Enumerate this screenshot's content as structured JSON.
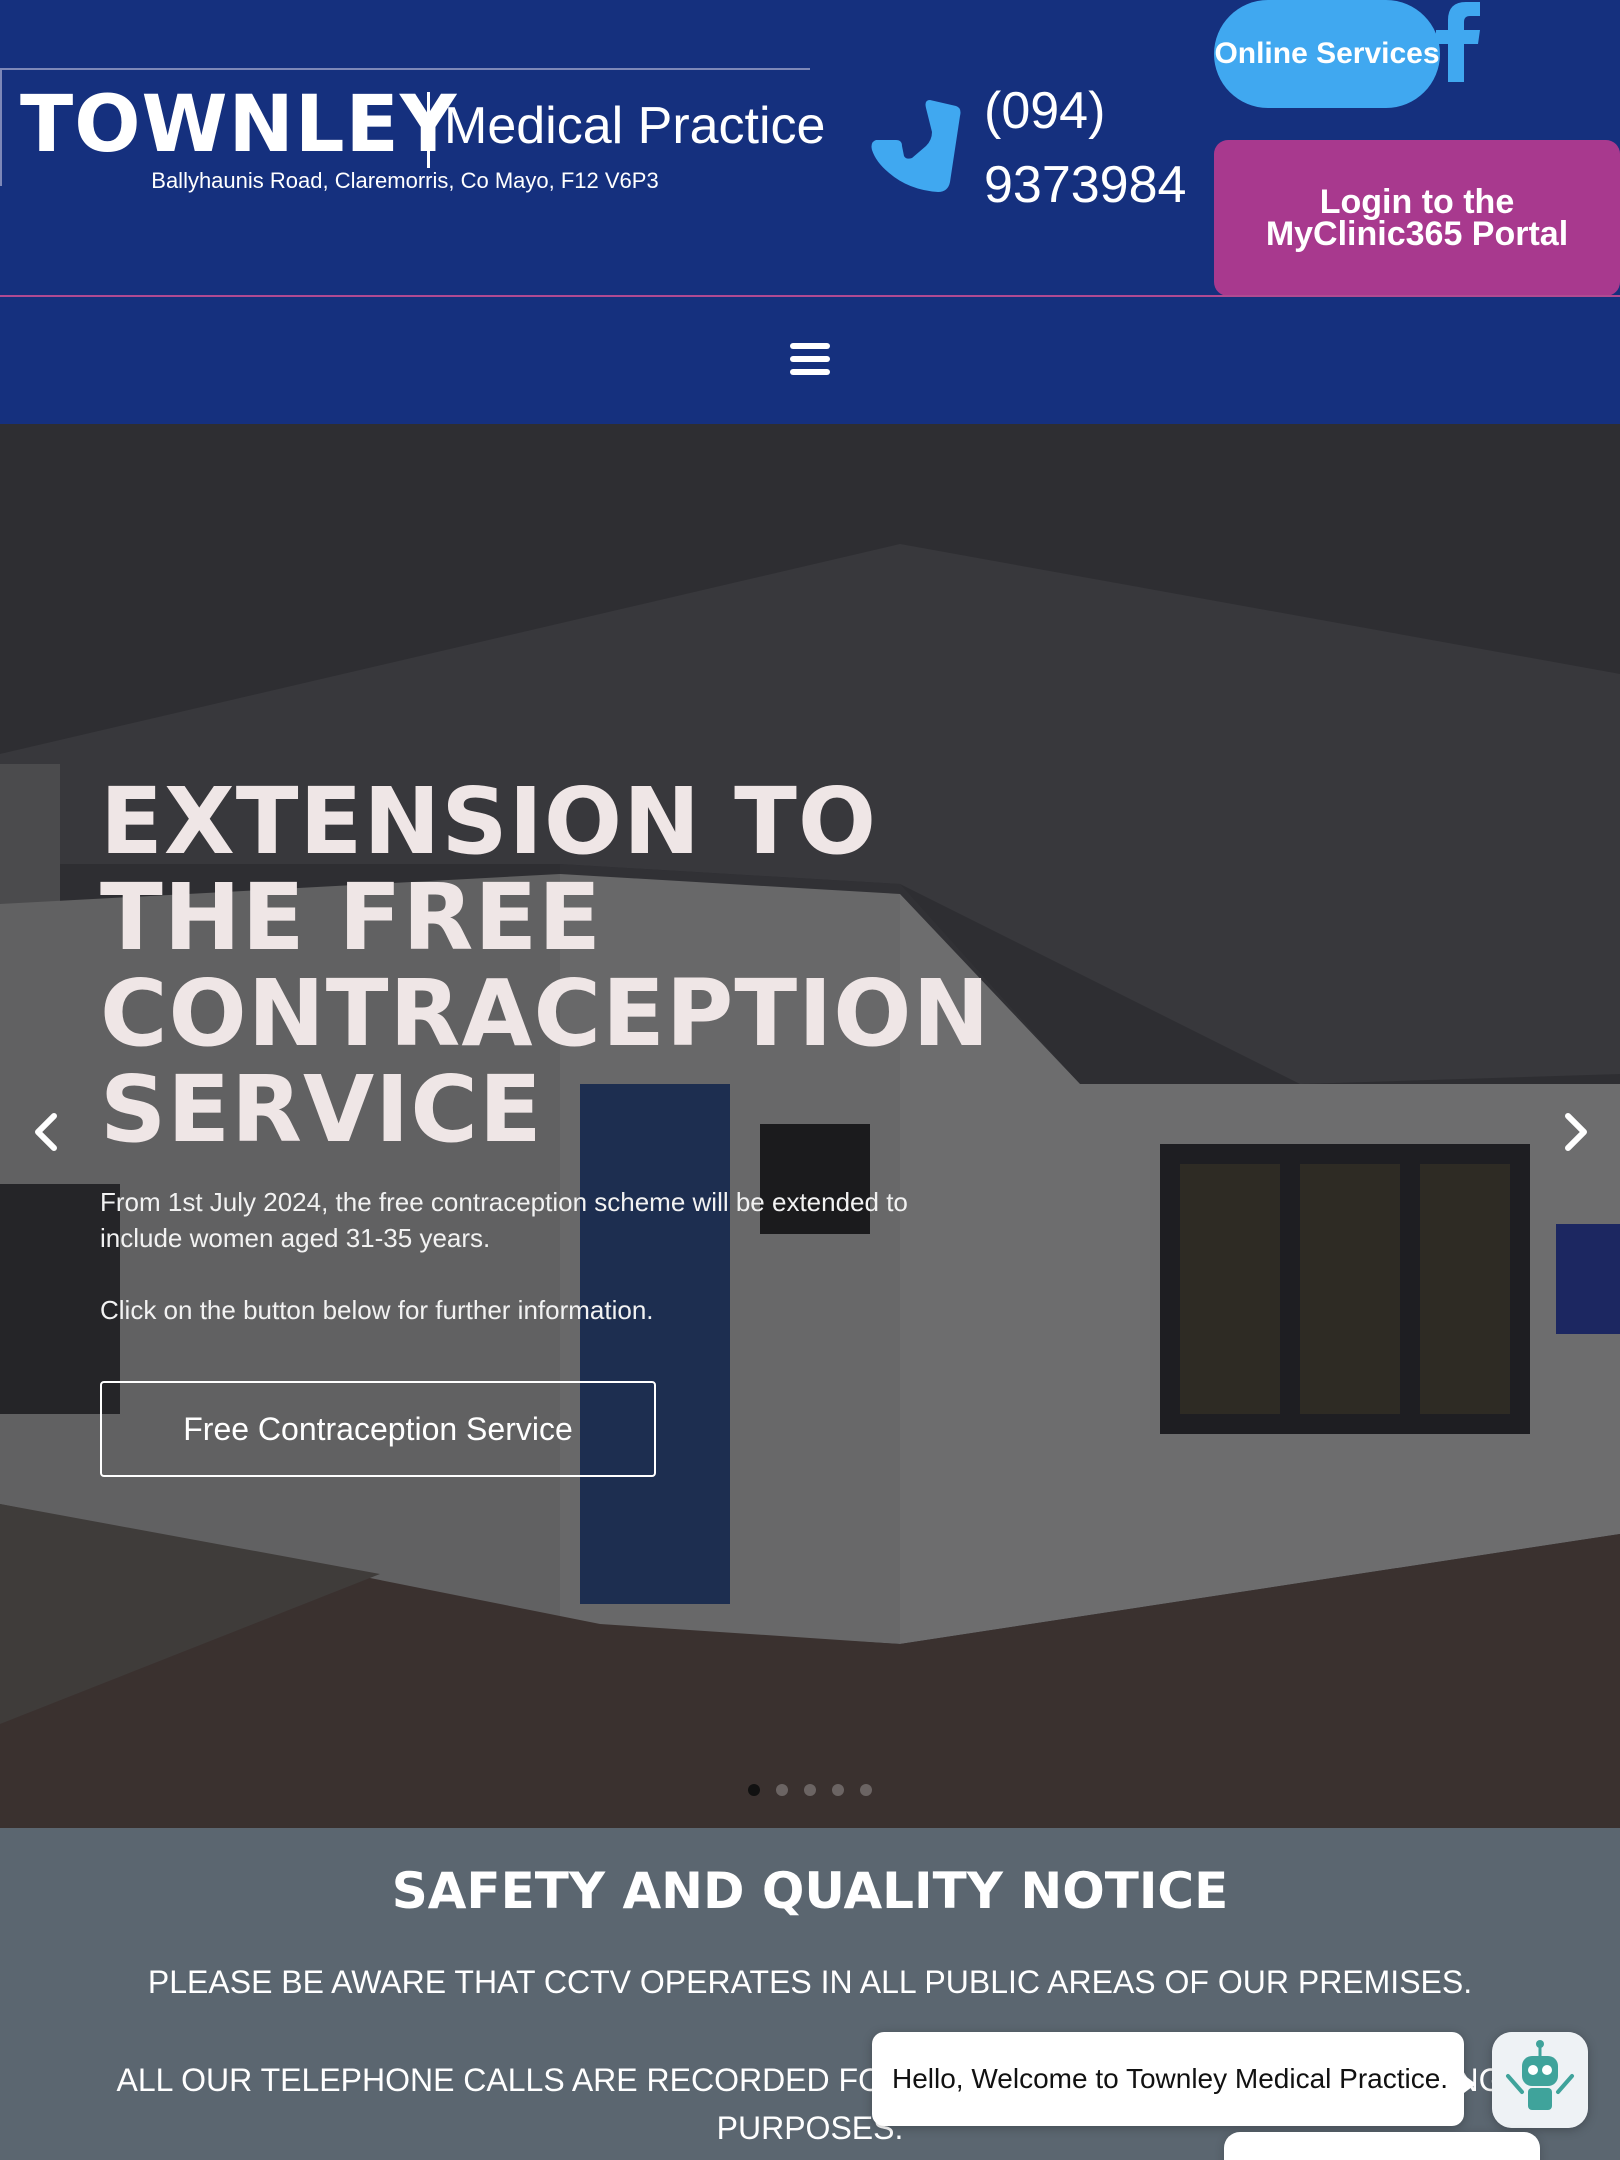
{
  "header": {
    "logo_name": "TOWNLEY",
    "logo_subtitle": "Medical Practice",
    "address": "Ballyhaunis Road, Claremorris, Co Mayo, F12 V6P3",
    "phone_line1": "(094)",
    "phone_line2": "9373984",
    "online_services_label": "Online Services",
    "portal_label": "Login to the MyClinic365 Portal",
    "icons": {
      "phone": "phone-icon",
      "facebook": "facebook-icon",
      "menu": "menu-icon"
    }
  },
  "hero": {
    "title": "EXTENSION TO THE FREE CONTRACEPTION SERVICE",
    "paragraph1": "From 1st July 2024, the free contraception scheme will be extended to include women aged 31-35 years.",
    "paragraph2": "Click on the button below for further information.",
    "button_label": "Free Contraception Service",
    "slide_count": 5,
    "active_slide": 1
  },
  "notice": {
    "title": "SAFETY AND QUALITY NOTICE",
    "line1": "PLEASE BE AWARE THAT CCTV OPERATES IN ALL PUBLIC AREAS OF OUR PREMISES.",
    "line2": "ALL OUR TELEPHONE CALLS ARE RECORDED FOR TRAINING AND QUALITY MONITORING PURPOSES."
  },
  "chat": {
    "greeting": "Hello, Welcome to Townley Medical Practice."
  },
  "colors": {
    "header_bg": "#15307e",
    "online_button": "#40a8f0",
    "portal_button": "#a8398e",
    "notice_bg": "#5b6670"
  }
}
